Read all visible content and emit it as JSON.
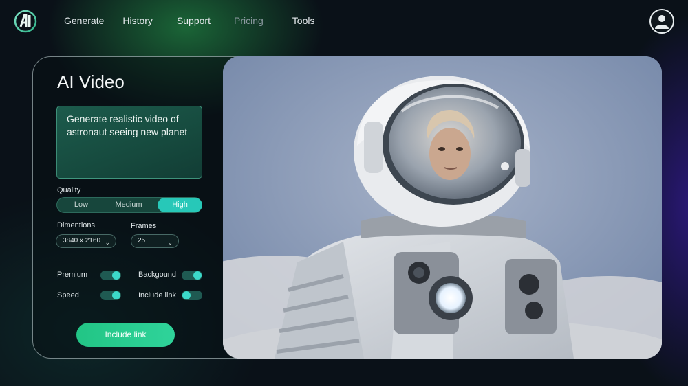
{
  "nav": {
    "items": [
      {
        "label": "Generate"
      },
      {
        "label": "History"
      },
      {
        "label": "Support"
      },
      {
        "label": "Pricing"
      },
      {
        "label": "Tools"
      }
    ]
  },
  "panel": {
    "title": "AI Video",
    "prompt": "Generate realistic video of astronaut seeing new planet",
    "quality": {
      "label": "Quality",
      "options": [
        "Low",
        "Medium",
        "High"
      ],
      "selected": "High"
    },
    "dimensions": {
      "label": "Dimentions",
      "value": "3840 x 2160"
    },
    "frames": {
      "label": "Frames",
      "value": "25"
    },
    "toggles": [
      {
        "label": "Premium",
        "on": true
      },
      {
        "label": "Backgound",
        "on": true
      },
      {
        "label": "Speed",
        "on": true
      },
      {
        "label": "Include link",
        "on": false
      }
    ],
    "cta": "Include link"
  },
  "colors": {
    "accent": "#27c8b8",
    "cta": "#22c585",
    "background": "#0a1118"
  },
  "icons": {
    "logo": "ai-logo",
    "avatar": "user-icon",
    "chevron": "chevron-down-icon"
  }
}
